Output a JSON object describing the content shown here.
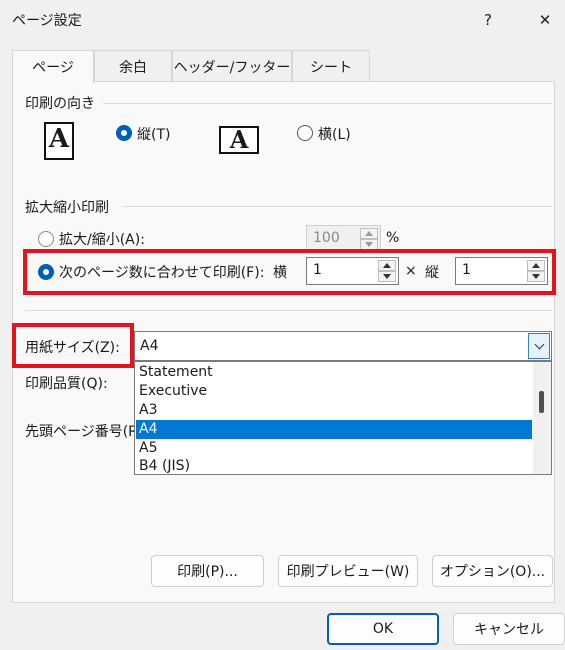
{
  "window": {
    "title": "ページ設定",
    "help_label": "?",
    "close_label": "✕"
  },
  "tabs": [
    {
      "label": "ページ",
      "active": true
    },
    {
      "label": "余白",
      "active": false
    },
    {
      "label": "ヘッダー/フッター",
      "active": false
    },
    {
      "label": "シート",
      "active": false
    }
  ],
  "orientation": {
    "group_label": "印刷の向き",
    "portrait_label": "縦(T)",
    "landscape_label": "横(L)",
    "icon_letter": "A",
    "selected": "portrait"
  },
  "scaling": {
    "group_label": "拡大縮小印刷",
    "zoom_label": "拡大/縮小(A):",
    "zoom_value": "100",
    "zoom_unit": "%",
    "fit_label": "次のページ数に合わせて印刷(F):",
    "width_label": "横",
    "width_value": "1",
    "times": "×",
    "height_label": "縦",
    "height_value": "1",
    "selected": "fit"
  },
  "paper": {
    "label": "用紙サイズ(Z):",
    "value": "A4",
    "options": [
      "Statement",
      "Executive",
      "A3",
      "A4",
      "A5",
      "B4 (JIS)"
    ],
    "selected_index": 3
  },
  "quality": {
    "label": "印刷品質(Q):"
  },
  "first_page": {
    "label": "先頭ページ番号(R"
  },
  "actions": {
    "print": "印刷(P)...",
    "preview": "印刷プレビュー(W)",
    "options": "オプション(O)..."
  },
  "footer": {
    "ok": "OK",
    "cancel": "キャンセル"
  },
  "colors": {
    "accent": "#005fb8",
    "highlight": "#0078d7",
    "annotation_red": "#e3141d"
  }
}
